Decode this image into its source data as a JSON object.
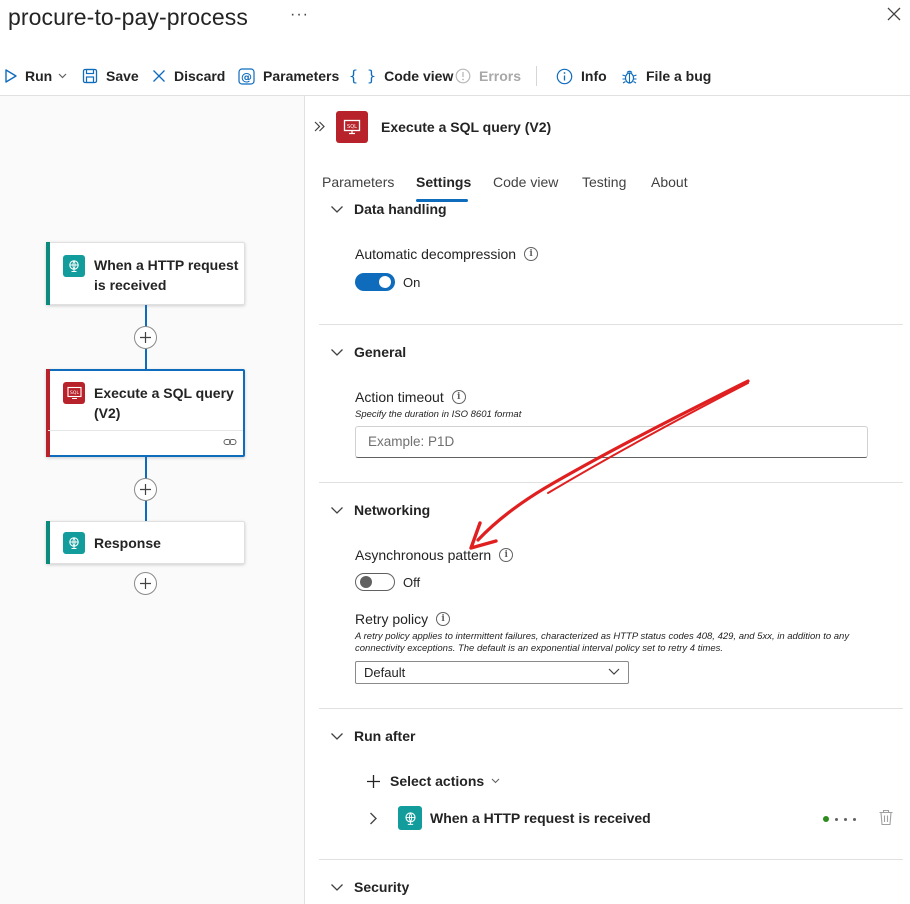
{
  "window": {
    "title": "procure-to-pay-process",
    "more_label": "···"
  },
  "toolbar": {
    "run": "Run",
    "save": "Save",
    "discard": "Discard",
    "parameters": "Parameters",
    "code_view": "Code view",
    "errors": "Errors",
    "info": "Info",
    "file_bug": "File a bug"
  },
  "canvas": {
    "nodes": [
      {
        "label": "When a HTTP request is received",
        "line1": "When a HTTP request",
        "line2": "is received",
        "accent": "#0c8a7e",
        "icon": "http-request-icon"
      },
      {
        "label": "Execute a SQL query (V2)",
        "line1": "Execute a SQL query",
        "line2": "(V2)",
        "accent": "#b8222a",
        "icon": "sql-icon",
        "selected": true
      },
      {
        "label": "Response",
        "line1": "Response",
        "accent": "#0c8a7e",
        "icon": "http-response-icon"
      }
    ]
  },
  "panel": {
    "title": "Execute a SQL query (V2)",
    "tabs": [
      "Parameters",
      "Settings",
      "Code view",
      "Testing",
      "About"
    ],
    "active_tab": "Settings",
    "sections": {
      "data_handling": {
        "title": "Data handling",
        "auto_decompression_label": "Automatic decompression",
        "auto_decompression_value": "On"
      },
      "general": {
        "title": "General",
        "timeout_label": "Action timeout",
        "timeout_hint": "Specify the duration in ISO 8601 format",
        "timeout_placeholder": "Example: P1D"
      },
      "networking": {
        "title": "Networking",
        "async_label": "Asynchronous pattern",
        "async_value": "Off",
        "retry_label": "Retry policy",
        "retry_hint_line1": "A retry policy applies to intermittent failures, characterized as HTTP status codes 408, 429, and 5xx, in addition to any",
        "retry_hint_line2": "connectivity exceptions. The default is an exponential interval policy set to retry 4 times.",
        "retry_value": "Default"
      },
      "run_after": {
        "title": "Run after",
        "select_actions": "Select actions",
        "item": "When a HTTP request is received"
      },
      "security": {
        "title": "Security"
      }
    }
  },
  "colors": {
    "accent_blue": "#0f6cbd",
    "sql_red": "#b8222a",
    "http_teal": "#139c9c",
    "annotation_red": "#e02020",
    "success_green": "#2e8b1e"
  }
}
